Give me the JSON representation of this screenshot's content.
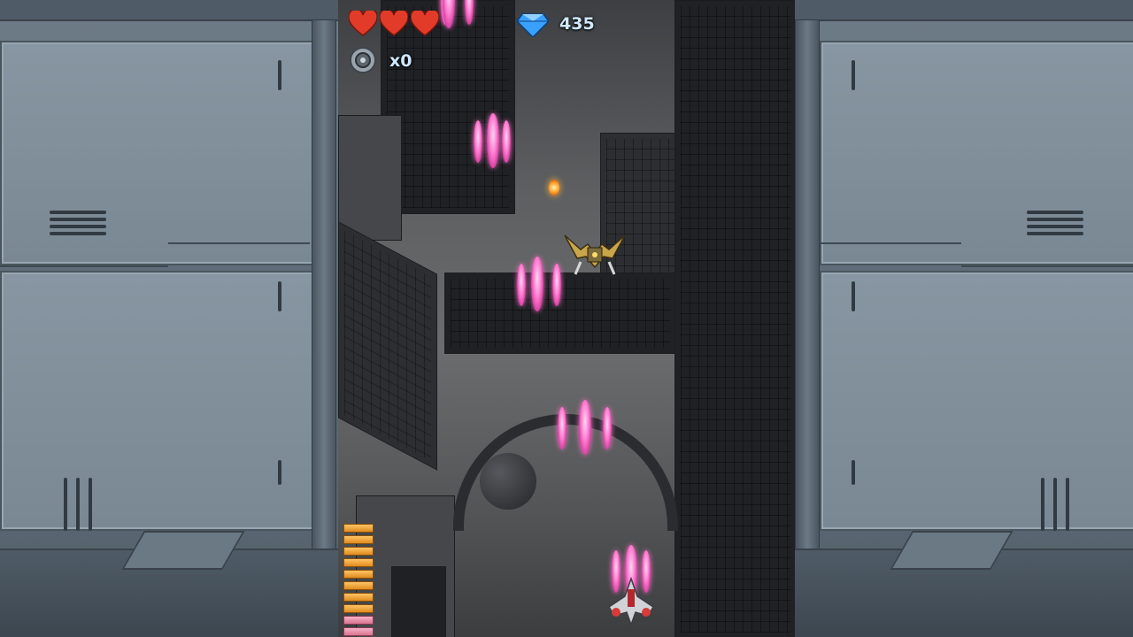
{
  "hud": {
    "lives": 3,
    "gems_count": "435",
    "bombs_count": "x0",
    "power_level": 10
  },
  "icons": {
    "life": "heart-icon",
    "gem": "blue-diamond-icon",
    "bomb": "bomb-ring-icon"
  },
  "colors": {
    "heart": "#e23b2a",
    "gem": "#3aa0ff",
    "player_bullet": "#ff6fcf",
    "enemy_bullet": "#ff9a1f",
    "hud_text": "#cfe8ff"
  }
}
